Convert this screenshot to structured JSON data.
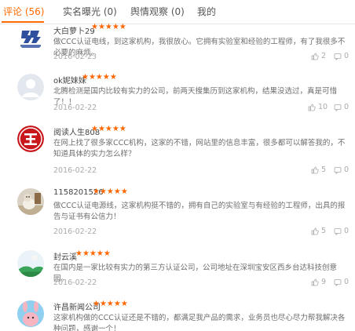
{
  "tabs": [
    {
      "label": "评论 (56)"
    },
    {
      "label": "实名曝光 (0)"
    },
    {
      "label": "舆情观察 (0)"
    },
    {
      "label": "我的"
    }
  ],
  "colors": {
    "accent": "#ff6a00",
    "star": "#ff6600"
  },
  "stars_text": "★★★★★",
  "reviews": [
    {
      "name": "大白萝卜29",
      "content": "做CCC认证电线，到这家机构，我很放心。它拥有实验室和经验的工程师，有了我很多不必要的麻烦。",
      "date": "2016-02-23",
      "likes": "2",
      "comments": "0",
      "avatar": "logo-avatar"
    },
    {
      "name": "ok妮妹妹",
      "content": "北腾检测是国内比较有实力的公司，前两天搜集历到这家机构，结果没选过，真是可惜了！！",
      "date": "2016-02-22",
      "likes": "10",
      "comments": "0",
      "avatar": "default-avatar"
    },
    {
      "name": "阅读人生808",
      "content": "在网上找了很多家CCC机构，这家的不错，网站里的信息丰富，很多都可以解答我的，不知道具体的实力怎么样？",
      "date": "2016-02-22",
      "likes": "5",
      "comments": "0",
      "avatar": "red-emblem-avatar"
    },
    {
      "name": "1158201526",
      "content": "做CCC认证电源线，这家机构挺不错的，拥有自己的实验室与有经验的工程师，出具的报告与证书有公信力！",
      "date": "2016-02-22",
      "likes": "5",
      "comments": "0",
      "avatar": "photo-avatar"
    },
    {
      "name": "封云溪",
      "content": "在国内是一家比较有实力的第三方认证公司，公司地址在深圳宝安区西乡台达科技创意园。",
      "date": "2016-02-22",
      "likes": "9",
      "comments": "0",
      "avatar": "landscape-avatar"
    },
    {
      "name": "许昌新闻公司",
      "content": "这家机构做的CCC认证还是不错的，都满足我产品的需求，业务员也尽心尽力帮我解决各种问题，感谢一个！",
      "date": "",
      "likes": "",
      "comments": "",
      "avatar": "cartoon-avatar"
    }
  ]
}
